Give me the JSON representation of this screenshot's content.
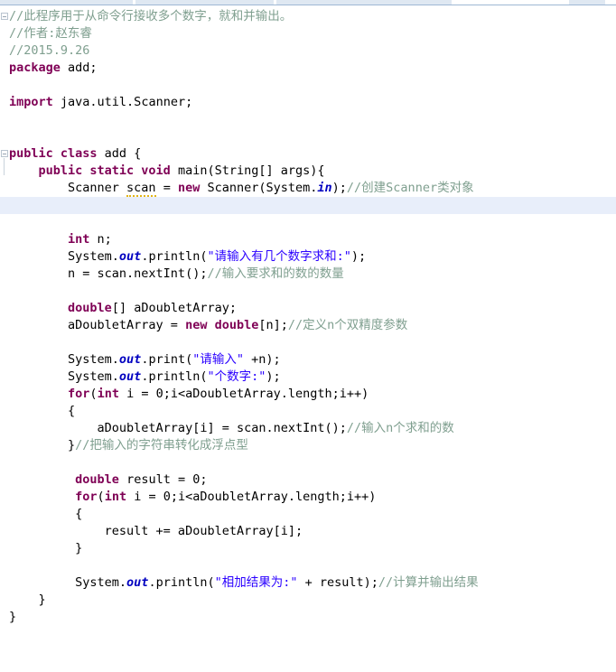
{
  "window": {
    "app": "eclipse-java-editor",
    "tab_strip_color": "#dfe8f2",
    "tab_border_color": "#9fb8d4"
  },
  "theme": {
    "background": "#ffffff",
    "default_text": "#000000",
    "keyword": "#7f0055",
    "string": "#2a00ff",
    "comment": "#7f9f8f",
    "static_field": "#0000c0",
    "current_line_highlight": "#e8eefa",
    "warning_underline": "#e2b416",
    "gutter_marker_border": "#b9c4cf"
  },
  "editor": {
    "current_line_index": 10,
    "warning_token": "scan",
    "fold_markers": [
      {
        "line_index": 0,
        "label": "collapse-fold-comment-block"
      },
      {
        "line_index": 8,
        "label": "collapse-fold-main-method"
      }
    ],
    "lines": [
      {
        "i": 0,
        "indent": 0,
        "tokens": [
          {
            "t": "cmt",
            "v": "//此程序用于从命令行接收多个数字，就和并输出。"
          }
        ]
      },
      {
        "i": 1,
        "indent": 0,
        "tokens": [
          {
            "t": "cmt",
            "v": "//作者:赵东睿"
          }
        ]
      },
      {
        "i": 2,
        "indent": 0,
        "tokens": [
          {
            "t": "cmt",
            "v": "//2015.9.26"
          }
        ]
      },
      {
        "i": 3,
        "indent": 0,
        "tokens": [
          {
            "t": "kw",
            "v": "package"
          },
          {
            "t": "plain",
            "v": " add;"
          }
        ]
      },
      {
        "i": 4,
        "indent": 0,
        "tokens": []
      },
      {
        "i": 5,
        "indent": 0,
        "tokens": [
          {
            "t": "kw",
            "v": "import"
          },
          {
            "t": "plain",
            "v": " java.util.Scanner;"
          }
        ]
      },
      {
        "i": 6,
        "indent": 0,
        "tokens": []
      },
      {
        "i": 7,
        "indent": 0,
        "tokens": []
      },
      {
        "i": 8,
        "indent": 0,
        "tokens": [
          {
            "t": "kw",
            "v": "public class"
          },
          {
            "t": "plain",
            "v": " add {"
          }
        ]
      },
      {
        "i": 9,
        "indent": 0,
        "tokens": [
          {
            "t": "plain",
            "v": "    "
          },
          {
            "t": "kw",
            "v": "public static void"
          },
          {
            "t": "plain",
            "v": " main(String[] args){"
          }
        ]
      },
      {
        "i": 10,
        "indent": 0,
        "tokens": [
          {
            "t": "plain",
            "v": "        Scanner "
          },
          {
            "t": "warn",
            "v": "scan"
          },
          {
            "t": "plain",
            "v": " = "
          },
          {
            "t": "kw",
            "v": "new"
          },
          {
            "t": "plain",
            "v": " Scanner(System."
          },
          {
            "t": "fld",
            "v": "in"
          },
          {
            "t": "plain",
            "v": ");"
          },
          {
            "t": "cmt",
            "v": "//创建Scanner类对象"
          }
        ]
      },
      {
        "i": 11,
        "indent": 0,
        "tokens": []
      },
      {
        "i": 12,
        "indent": 0,
        "tokens": []
      },
      {
        "i": 13,
        "indent": 0,
        "tokens": [
          {
            "t": "plain",
            "v": "        "
          },
          {
            "t": "kw",
            "v": "int"
          },
          {
            "t": "plain",
            "v": " n;"
          }
        ]
      },
      {
        "i": 14,
        "indent": 0,
        "tokens": [
          {
            "t": "plain",
            "v": "        System."
          },
          {
            "t": "fld",
            "v": "out"
          },
          {
            "t": "plain",
            "v": ".println("
          },
          {
            "t": "str",
            "v": "\"请输入有几个数字求和:\""
          },
          {
            "t": "plain",
            "v": ");"
          }
        ]
      },
      {
        "i": 15,
        "indent": 0,
        "tokens": [
          {
            "t": "plain",
            "v": "        n = scan.nextInt();"
          },
          {
            "t": "cmt",
            "v": "//输入要求和的数的数量"
          }
        ]
      },
      {
        "i": 16,
        "indent": 0,
        "tokens": []
      },
      {
        "i": 17,
        "indent": 0,
        "tokens": [
          {
            "t": "plain",
            "v": "        "
          },
          {
            "t": "kw",
            "v": "double"
          },
          {
            "t": "plain",
            "v": "[] aDoubletArray;"
          }
        ]
      },
      {
        "i": 18,
        "indent": 0,
        "tokens": [
          {
            "t": "plain",
            "v": "        aDoubletArray = "
          },
          {
            "t": "kw",
            "v": "new double"
          },
          {
            "t": "plain",
            "v": "[n];"
          },
          {
            "t": "cmt",
            "v": "//定义n个双精度参数"
          }
        ]
      },
      {
        "i": 19,
        "indent": 0,
        "tokens": []
      },
      {
        "i": 20,
        "indent": 0,
        "tokens": [
          {
            "t": "plain",
            "v": "        System."
          },
          {
            "t": "fld",
            "v": "out"
          },
          {
            "t": "plain",
            "v": ".print("
          },
          {
            "t": "str",
            "v": "\"请输入\""
          },
          {
            "t": "plain",
            "v": " +n);"
          }
        ]
      },
      {
        "i": 21,
        "indent": 0,
        "tokens": [
          {
            "t": "plain",
            "v": "        System."
          },
          {
            "t": "fld",
            "v": "out"
          },
          {
            "t": "plain",
            "v": ".println("
          },
          {
            "t": "str",
            "v": "\"个数字:\""
          },
          {
            "t": "plain",
            "v": ");"
          }
        ]
      },
      {
        "i": 22,
        "indent": 0,
        "tokens": [
          {
            "t": "plain",
            "v": "        "
          },
          {
            "t": "kw",
            "v": "for"
          },
          {
            "t": "plain",
            "v": "("
          },
          {
            "t": "kw",
            "v": "int"
          },
          {
            "t": "plain",
            "v": " i = 0;i<aDoubletArray.length;i++)"
          }
        ]
      },
      {
        "i": 23,
        "indent": 0,
        "tokens": [
          {
            "t": "plain",
            "v": "        {"
          }
        ]
      },
      {
        "i": 24,
        "indent": 0,
        "tokens": [
          {
            "t": "plain",
            "v": "            aDoubletArray[i] = scan.nextInt();"
          },
          {
            "t": "cmt",
            "v": "//输入n个求和的数"
          }
        ]
      },
      {
        "i": 25,
        "indent": 0,
        "tokens": [
          {
            "t": "plain",
            "v": "        }"
          },
          {
            "t": "cmt",
            "v": "//把输入的字符串转化成浮点型"
          }
        ]
      },
      {
        "i": 26,
        "indent": 0,
        "tokens": []
      },
      {
        "i": 27,
        "indent": 0,
        "tokens": [
          {
            "t": "plain",
            "v": "         "
          },
          {
            "t": "kw",
            "v": "double"
          },
          {
            "t": "plain",
            "v": " result = 0;"
          }
        ]
      },
      {
        "i": 28,
        "indent": 0,
        "tokens": [
          {
            "t": "plain",
            "v": "         "
          },
          {
            "t": "kw",
            "v": "for"
          },
          {
            "t": "plain",
            "v": "("
          },
          {
            "t": "kw",
            "v": "int"
          },
          {
            "t": "plain",
            "v": " i = 0;i<aDoubletArray.length;i++)"
          }
        ]
      },
      {
        "i": 29,
        "indent": 0,
        "tokens": [
          {
            "t": "plain",
            "v": "         {"
          }
        ]
      },
      {
        "i": 30,
        "indent": 0,
        "tokens": [
          {
            "t": "plain",
            "v": "             result += aDoubletArray[i];"
          }
        ]
      },
      {
        "i": 31,
        "indent": 0,
        "tokens": [
          {
            "t": "plain",
            "v": "         }"
          }
        ]
      },
      {
        "i": 32,
        "indent": 0,
        "tokens": []
      },
      {
        "i": 33,
        "indent": 0,
        "tokens": [
          {
            "t": "plain",
            "v": "         System."
          },
          {
            "t": "fld",
            "v": "out"
          },
          {
            "t": "plain",
            "v": ".println("
          },
          {
            "t": "str",
            "v": "\"相加结果为:\""
          },
          {
            "t": "plain",
            "v": " + result);"
          },
          {
            "t": "cmt",
            "v": "//计算并输出结果"
          }
        ]
      },
      {
        "i": 34,
        "indent": 0,
        "tokens": [
          {
            "t": "plain",
            "v": "    }"
          }
        ]
      },
      {
        "i": 35,
        "indent": 0,
        "tokens": [
          {
            "t": "plain",
            "v": "}"
          }
        ]
      },
      {
        "i": 36,
        "indent": 0,
        "tokens": []
      },
      {
        "i": 37,
        "indent": 0,
        "tokens": []
      }
    ]
  }
}
